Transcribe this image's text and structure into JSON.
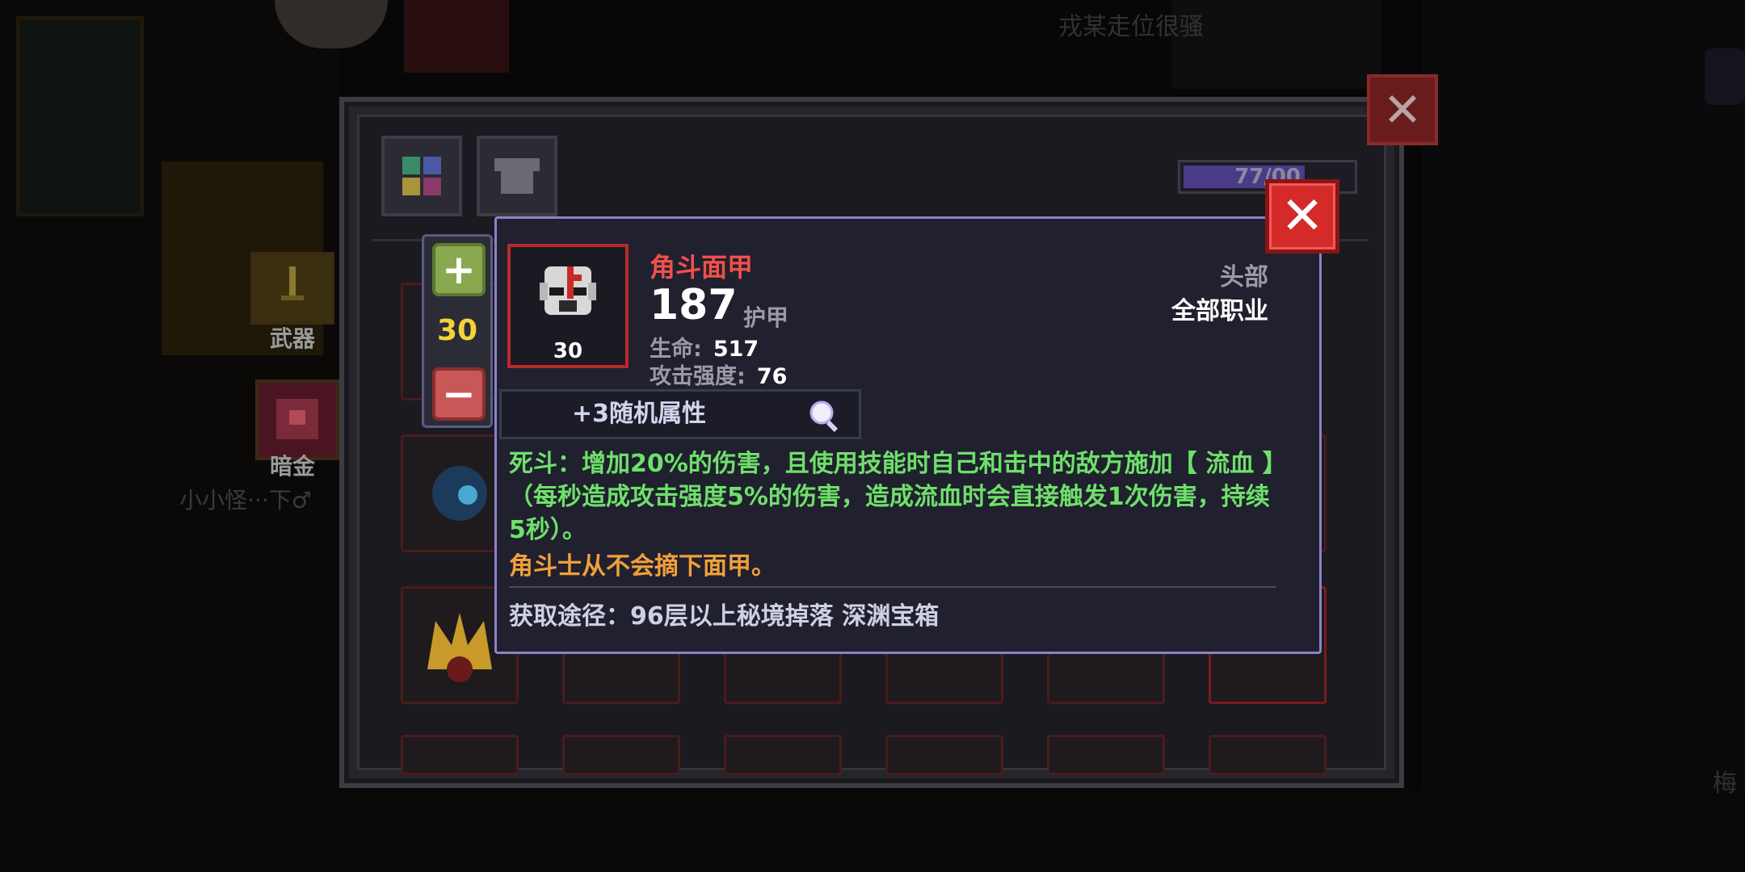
{
  "background": {
    "player_name_top": "戎某走位很骚",
    "player_name_left": "小小怪···下♂",
    "player_name_right": "梅",
    "side_weapon_label": "武器",
    "side_dark_gold_label": "暗金"
  },
  "inventory": {
    "count_text": "77/00",
    "close_label": "✕"
  },
  "stepper": {
    "plus_label": "+",
    "minus_label": "−",
    "level": "30"
  },
  "item": {
    "name": "角斗面甲",
    "icon": "gladiator-mask-icon",
    "level": "30",
    "armor_value": "187",
    "armor_label": "护甲",
    "stats": [
      {
        "label": "生命:",
        "value": "517"
      },
      {
        "label": "攻击强度:",
        "value": "76"
      }
    ],
    "slot": "头部",
    "class_requirement": "全部职业",
    "random_attributes": "+3随机属性",
    "effect": "死斗：增加20%的伤害，且使用技能时自己和击中的敌方施加【 流血 】（每秒造成攻击强度5%的伤害，造成流血时会直接触发1次伤害，持续5秒）。",
    "flavor": "角斗士从不会摘下面甲。",
    "source": "获取途径：96层以上秘境掉落 深渊宝箱",
    "close_label": "✕"
  },
  "colors": {
    "item_name": "#f0504a",
    "effect": "#6ee06a",
    "flavor": "#f0a03a",
    "level": "#f3d33a",
    "tooltip_border": "#8c82c8"
  }
}
